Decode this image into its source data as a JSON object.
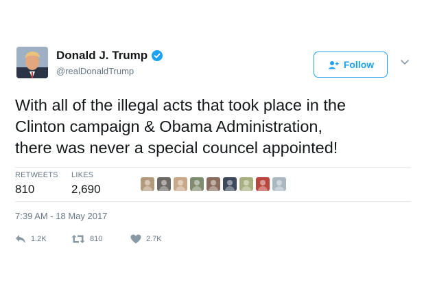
{
  "user": {
    "name": "Donald J. Trump",
    "handle": "@realDonaldTrump",
    "verified": true
  },
  "follow_button": {
    "label": "Follow"
  },
  "tweet": {
    "lines": [
      "With all of the illegal acts that took place in the",
      "Clinton campaign & Obama Administration,",
      "there was never a special councel appointed!"
    ],
    "timestamp": "7:39 AM - 18 May 2017"
  },
  "stats": {
    "retweets_label": "RETWEETS",
    "retweets_value": "810",
    "likes_label": "LIKES",
    "likes_value": "2,690"
  },
  "likers": [
    {
      "color": "#b49a7c"
    },
    {
      "color": "#6d6a66"
    },
    {
      "color": "#c9a88a"
    },
    {
      "color": "#7f8c6e"
    },
    {
      "color": "#8a6d5e"
    },
    {
      "color": "#3e4a5c"
    },
    {
      "color": "#a7b07e"
    },
    {
      "color": "#b8483f"
    },
    {
      "color": "#aab8c2"
    }
  ],
  "actions": {
    "reply_count": "1.2K",
    "retweet_count": "810",
    "like_count": "2.7K"
  },
  "colors": {
    "accent": "#1da1f2",
    "secondary_text": "#657786",
    "divider": "#e1e8ed"
  }
}
